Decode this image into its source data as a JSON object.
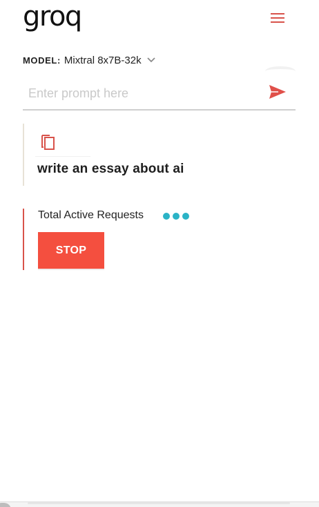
{
  "header": {
    "logo_text": "groq",
    "menu_icon": "hamburger-menu-icon"
  },
  "model": {
    "label": "MODEL:",
    "value": "Mixtral 8x7B-32k",
    "chevron_icon": "chevron-down-icon"
  },
  "prompt": {
    "placeholder": "Enter prompt here",
    "value": "",
    "send_icon": "send-icon"
  },
  "history": {
    "copy_icon": "copy-icon",
    "prompt_text": "write an essay about ai"
  },
  "requests": {
    "label": "Total Active Requests",
    "stop_label": "STOP"
  },
  "colors": {
    "accent": "#d8524a",
    "stop_button": "#f44f3f",
    "loading_dots": "#2bb3c6",
    "text": "#222222",
    "placeholder": "#c9c9c9"
  }
}
